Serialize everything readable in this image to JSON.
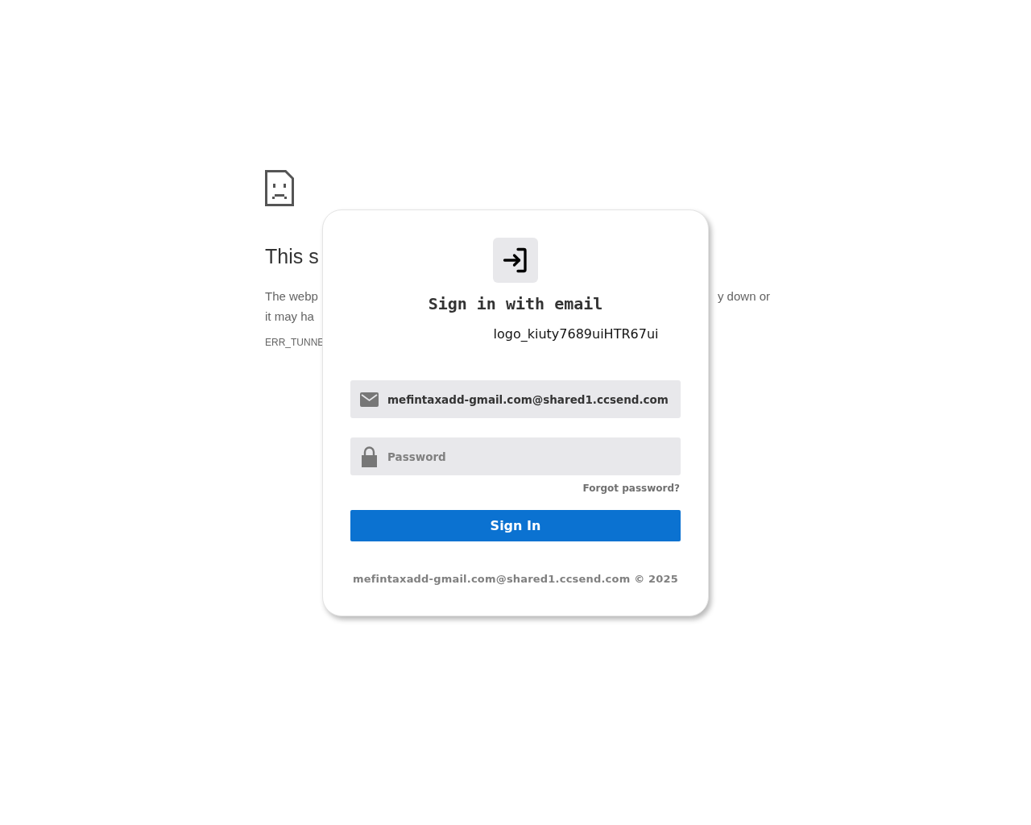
{
  "error_page": {
    "heading": "This s",
    "lines": [
      {
        "left": "The webp",
        "right": "y down or"
      },
      {
        "left": "it may ha"
      }
    ],
    "code": "ERR_TUNNE"
  },
  "dialog": {
    "title": "Sign in with email",
    "logo_alt": "logo_kiuty7689uiHTR67ui",
    "email": {
      "value": "mefintaxadd-gmail.com@shared1.ccsend.com"
    },
    "password": {
      "placeholder": "Password"
    },
    "forgot_link": "Forgot password?",
    "submit": "Sign In",
    "footer": "mefintaxadd-gmail.com@shared1.ccsend.com © 2025"
  }
}
